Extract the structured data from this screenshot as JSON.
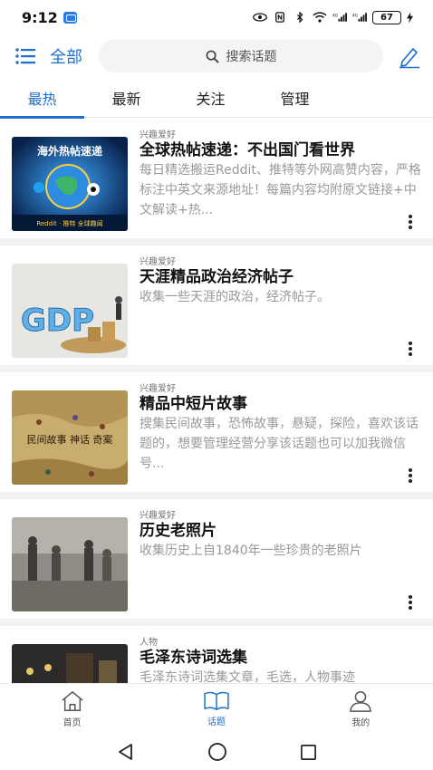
{
  "status_bar": {
    "time": "9:12",
    "battery": "67"
  },
  "header": {
    "category_label": "全部",
    "search_placeholder": "搜索话题"
  },
  "tabs": [
    {
      "label": "最热",
      "active": true
    },
    {
      "label": "最新",
      "active": false
    },
    {
      "label": "关注",
      "active": false
    },
    {
      "label": "管理",
      "active": false
    }
  ],
  "topics": [
    {
      "category": "兴趣爱好",
      "title": "全球热帖速递：不出国门看世界",
      "description": "每日精选搬运Reddit、推特等外网高赞内容，严格标注中英文来源地址！每篇内容均附原文链接+中文解读+热...",
      "thumb_text": "海外热帖速递",
      "thumb_caption": "Reddit · 推特 全球趣闻"
    },
    {
      "category": "兴趣爱好",
      "title": "天涯精品政治经济帖子",
      "description": "收集一些天涯的政治，经济帖子。",
      "thumb_text": "GDP"
    },
    {
      "category": "兴趣爱好",
      "title": "精品中短片故事",
      "description": "搜集民间故事，恐怖故事，悬疑，探险，喜欢该话题的，想要管理经营分享该话题也可以加我微信号...",
      "thumb_text": "民间故事 神话 奇案"
    },
    {
      "category": "兴趣爱好",
      "title": "历史老照片",
      "description": "收集历史上自1840年一些珍贵的老照片",
      "thumb_text": ""
    },
    {
      "category": "人物",
      "title": "毛泽东诗词选集",
      "description": "毛泽东诗词选集文章，毛选，人物事迹",
      "thumb_text": ""
    }
  ],
  "bottom_nav": [
    {
      "label": "首页",
      "icon": "home-icon",
      "active": false
    },
    {
      "label": "话题",
      "icon": "book-icon",
      "active": true
    },
    {
      "label": "我的",
      "icon": "user-icon",
      "active": false
    }
  ],
  "colors": {
    "accent": "#1e6fd0"
  }
}
